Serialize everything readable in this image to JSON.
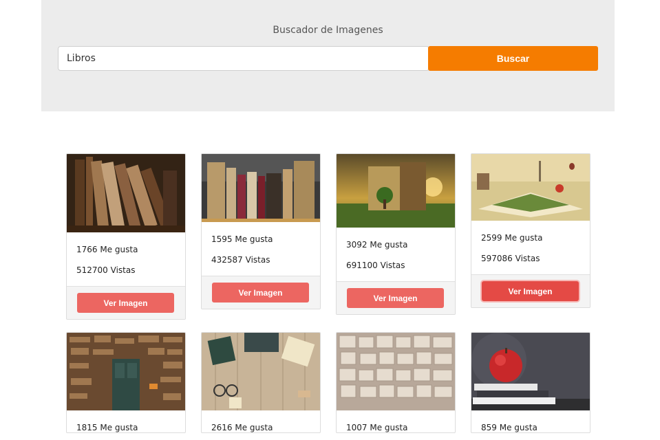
{
  "search": {
    "label": "Buscador de Imagenes",
    "value": "Libros",
    "button_label": "Buscar"
  },
  "cards": [
    {
      "likes": "1766 Me gusta",
      "views": "512700 Vistas",
      "button": "Ver Imagen",
      "image_desc": "old-books"
    },
    {
      "likes": "1595 Me gusta",
      "views": "432587 Vistas",
      "button": "Ver Imagen",
      "image_desc": "book-spines"
    },
    {
      "likes": "3092 Me gusta",
      "views": "691100 Vistas",
      "button": "Ver Imagen",
      "image_desc": "book-landscape"
    },
    {
      "likes": "2599 Me gusta",
      "views": "597086 Vistas",
      "button": "Ver Imagen",
      "image_desc": "open-book-fantasy"
    },
    {
      "likes": "1815 Me gusta",
      "image_desc": "book-wall-door"
    },
    {
      "likes": "2616 Me gusta",
      "image_desc": "typewriter-desk"
    },
    {
      "likes": "1007 Me gusta",
      "image_desc": "pages-wall"
    },
    {
      "likes": "859 Me gusta",
      "image_desc": "apple-on-books"
    }
  ]
}
